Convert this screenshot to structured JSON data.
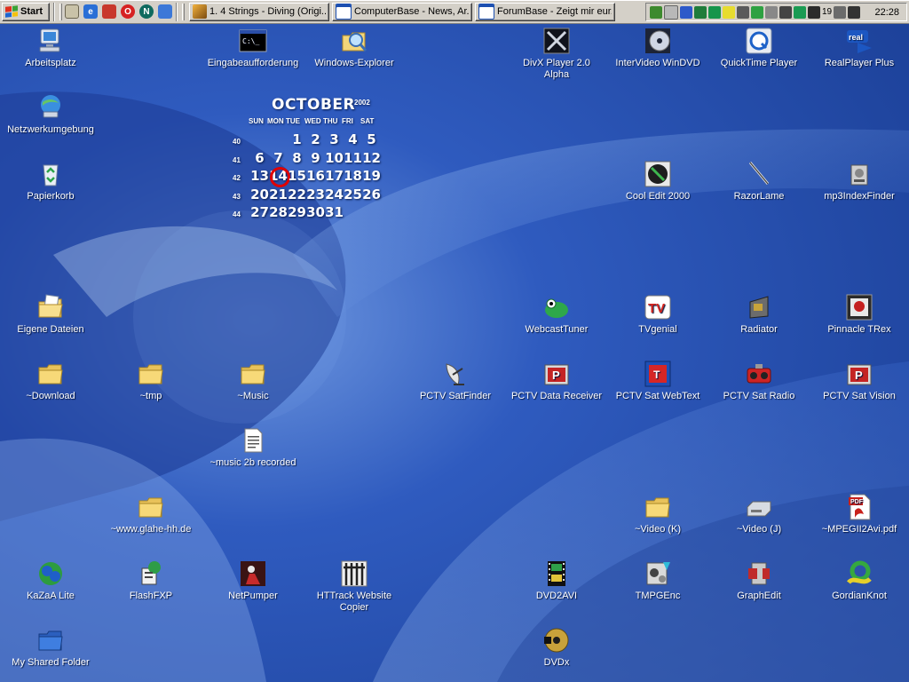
{
  "taskbar": {
    "start_label": "Start",
    "quick_launch": [
      "show-desktop-icon",
      "internet-explorer-icon",
      "outlook-express-icon",
      "opera-icon",
      "netscape-icon",
      "refresh-icon"
    ],
    "tasks": [
      {
        "label": "1. 4 Strings - Diving (Origi...",
        "icon": "winamp-icon"
      },
      {
        "label": "ComputerBase - News, Ar...",
        "icon": "browser-window-icon"
      },
      {
        "label": "ForumBase - Zeigt mir eur...",
        "icon": "browser-window-icon"
      }
    ],
    "tray_temp": "19",
    "clock": "22:28"
  },
  "calendar": {
    "month": "OCTOBER",
    "year": "2002",
    "day_headers": [
      "SUN",
      "MON",
      "TUE",
      "WED",
      "THU",
      "FRI",
      "SAT"
    ],
    "weeks": [
      {
        "week": "40",
        "days": [
          "",
          "",
          "1",
          "2",
          "3",
          "4",
          "5"
        ]
      },
      {
        "week": "41",
        "days": [
          "6",
          "7",
          "8",
          "9",
          "10",
          "11",
          "12"
        ]
      },
      {
        "week": "42",
        "days": [
          "13",
          "14",
          "15",
          "16",
          "17",
          "18",
          "19"
        ]
      },
      {
        "week": "43",
        "days": [
          "20",
          "21",
          "22",
          "23",
          "24",
          "25",
          "26"
        ]
      },
      {
        "week": "44",
        "days": [
          "27",
          "28",
          "29",
          "30",
          "31",
          "",
          ""
        ]
      }
    ],
    "today": "14"
  },
  "icons": [
    {
      "label": "Arbeitsplatz",
      "icon": "my-computer-icon"
    },
    {
      "label": "Netzwerkumgebung",
      "icon": "network-icon"
    },
    {
      "label": "Papierkorb",
      "icon": "recycle-bin-icon"
    },
    {
      "label": "Eigene Dateien",
      "icon": "my-documents-icon"
    },
    {
      "label": "~Download",
      "icon": "folder-icon"
    },
    {
      "label": "~tmp",
      "icon": "folder-icon"
    },
    {
      "label": "~Music",
      "icon": "folder-icon"
    },
    {
      "label": "~music 2b recorded",
      "icon": "text-file-icon"
    },
    {
      "label": "~www.glahe-hh.de",
      "icon": "folder-icon"
    },
    {
      "label": "KaZaA Lite",
      "icon": "kazaa-icon"
    },
    {
      "label": "FlashFXP",
      "icon": "flashfxp-icon"
    },
    {
      "label": "NetPumper",
      "icon": "netpumper-icon"
    },
    {
      "label": "HTTrack Website Copier",
      "icon": "httrack-icon"
    },
    {
      "label": "My Shared Folder",
      "icon": "shared-folder-icon"
    },
    {
      "label": "Eingabeaufforderung",
      "icon": "command-prompt-icon"
    },
    {
      "label": "Windows-Explorer",
      "icon": "explorer-icon"
    },
    {
      "label": "DivX Player 2.0 Alpha",
      "icon": "divx-icon"
    },
    {
      "label": "InterVideo WinDVD",
      "icon": "windvd-icon"
    },
    {
      "label": "QuickTime Player",
      "icon": "quicktime-icon"
    },
    {
      "label": "RealPlayer Plus",
      "icon": "realplayer-icon"
    },
    {
      "label": "Cool Edit 2000",
      "icon": "cooledit-icon"
    },
    {
      "label": "RazorLame",
      "icon": "razorlame-icon"
    },
    {
      "label": "mp3IndexFinder",
      "icon": "mp3indexfinder-icon"
    },
    {
      "label": "WebcastTuner",
      "icon": "webcasttuner-icon"
    },
    {
      "label": "TVgenial",
      "icon": "tvgenial-icon"
    },
    {
      "label": "Radiator",
      "icon": "radiator-icon"
    },
    {
      "label": "Pinnacle TRex",
      "icon": "pinnacle-trex-icon"
    },
    {
      "label": "PCTV SatFinder",
      "icon": "satellite-dish-icon"
    },
    {
      "label": "PCTV Data Receiver",
      "icon": "pctv-icon"
    },
    {
      "label": "PCTV Sat WebText",
      "icon": "pctv-webtext-icon"
    },
    {
      "label": "PCTV Sat Radio",
      "icon": "radio-icon"
    },
    {
      "label": "PCTV Sat Vision",
      "icon": "pctv-icon"
    },
    {
      "label": "~Video (K)",
      "icon": "folder-icon"
    },
    {
      "label": "~Video (J)",
      "icon": "drive-icon"
    },
    {
      "label": "~MPEGII2Avi.pdf",
      "icon": "pdf-icon"
    },
    {
      "label": "DVD2AVI",
      "icon": "film-icon"
    },
    {
      "label": "TMPGEnc",
      "icon": "tmpgenc-icon"
    },
    {
      "label": "GraphEdit",
      "icon": "graphedit-icon"
    },
    {
      "label": "GordianKnot",
      "icon": "gordianknot-icon"
    },
    {
      "label": "DVDx",
      "icon": "dvdx-icon"
    }
  ]
}
